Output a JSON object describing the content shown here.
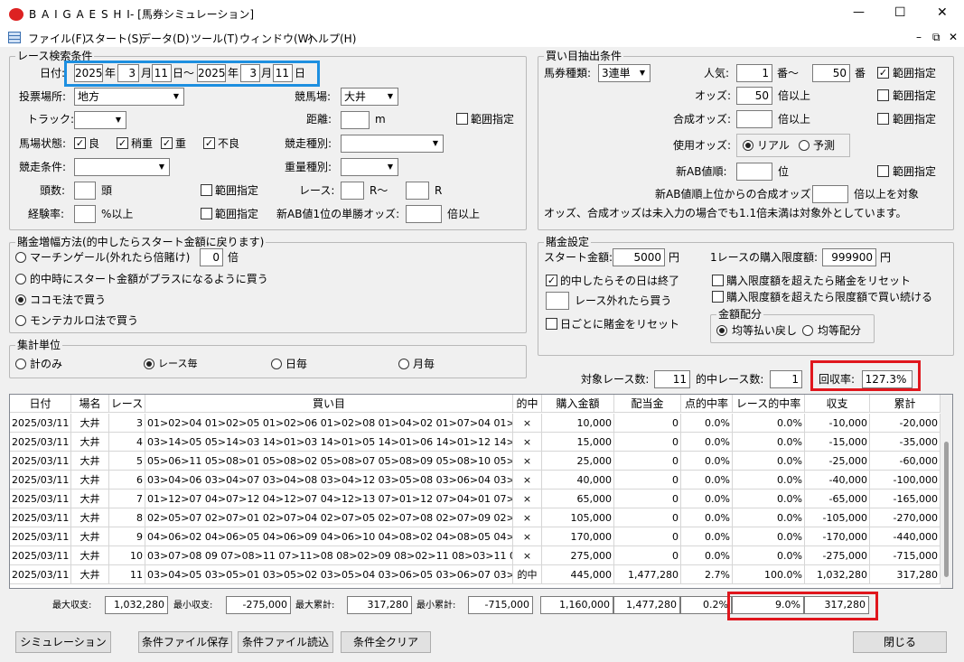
{
  "window": {
    "app_name": "B A I G A E S H I",
    "doc_title": "- [馬券シミュレーション]",
    "min": "—",
    "max": "☐",
    "close": "✕"
  },
  "menu": [
    "ファイル(F)",
    "スタート(S)",
    "データ(D)",
    "ツール(T)",
    "ウィンドウ(W)",
    "ヘルプ(H)"
  ],
  "mdi": [
    "–",
    "⧉",
    "✕"
  ],
  "race_search": {
    "legend": "レース検索条件",
    "date_label": "日付:",
    "y1": "2025",
    "y_unit": "年",
    "m1": "3",
    "m_unit": "月",
    "d1": "11",
    "d_unit_tilde": "日〜",
    "y2": "2025",
    "m2": "3",
    "d2": "11",
    "d_unit": "日",
    "venue_label": "投票場所:",
    "venue": "地方",
    "track_label": "競馬場:",
    "track": "大井",
    "course_label": "トラック:",
    "course": "",
    "distance_label": "距離:",
    "distance": "",
    "distance_unit": "m",
    "range": "範囲指定",
    "condition_label": "馬場状態:",
    "cond": [
      "良",
      "稍重",
      "重",
      "不良"
    ],
    "race_type_label": "競走種別:",
    "race_type": "",
    "race_cond_label": "競走条件:",
    "race_cond": "",
    "weight_label": "重量種別:",
    "weight": "",
    "heads_label": "頭数:",
    "heads_unit": "頭",
    "race_label": "レース:",
    "race_from": "",
    "race_mid": "R〜",
    "race_to": "",
    "race_unit": "R",
    "exp_label": "経験率:",
    "exp_unit": "%以上",
    "ab_label": "新AB値1位の単勝オッズ:",
    "ab_unit": "倍以上"
  },
  "bet_extract": {
    "legend": "買い目抽出条件",
    "type_label": "馬券種類:",
    "type": "3連単",
    "pop_label": "人気:",
    "pop_from": "1",
    "pop_mid": "番〜",
    "pop_to": "50",
    "pop_unit": "番",
    "range": "範囲指定",
    "odds_label": "オッズ:",
    "odds": "50",
    "odds_unit": "倍以上",
    "comb_label": "合成オッズ:",
    "comb_unit": "倍以上",
    "use_odds_label": "使用オッズ:",
    "real": "リアル",
    "pred": "予測",
    "ab_rank_label": "新AB値順:",
    "ab_rank_unit": "位",
    "ab_comb_label": "新AB値順上位からの合成オッズ",
    "ab_comb_unit": "倍以上を対象",
    "note": "オッズ、合成オッズは未入力の場合でも1.1倍未満は対象外としています。"
  },
  "increase": {
    "legend": "賭金増幅方法(的中したらスタート金額に戻ります)",
    "opt1": "マーチンゲール(外れたら倍賭け)",
    "opt1_val": "0",
    "opt1_unit": "倍",
    "opt2": "的中時にスタート金額がプラスになるように買う",
    "opt3": "ココモ法で買う",
    "opt4": "モンテカルロ法で買う"
  },
  "agg": {
    "legend": "集計単位",
    "o1": "計のみ",
    "o2": "レース毎",
    "o3": "日毎",
    "o4": "月毎"
  },
  "bet_set": {
    "legend": "賭金設定",
    "start_label": "スタート金額:",
    "start": "5000",
    "yen": "円",
    "limit_label": "1レースの購入限度額:",
    "limit": "999900",
    "c1": "的中したらその日は終了",
    "c2": "レース外れたら買う",
    "c3": "日ごとに賭金をリセット",
    "c4": "購入限度額を超えたら賭金をリセット",
    "c5": "購入限度額を超えたら限度額で買い続ける",
    "dist_legend": "金額配分",
    "d1": "均等払い戻し",
    "d2": "均等配分"
  },
  "summary": {
    "races_label": "対象レース数:",
    "races": "11",
    "hits_label": "的中レース数:",
    "hits": "1",
    "ret_label": "回収率:",
    "ret": "127.3%"
  },
  "grid": {
    "headers": [
      "日付",
      "場名",
      "レース",
      "買い目",
      "的中",
      "購入金額",
      "配当金",
      "点的中率",
      "レース的中率",
      "収支",
      "累計"
    ],
    "rows": [
      [
        "2025/03/11",
        "大井",
        "3",
        "01>02>04 01>02>05 01>02>06 01>02>08 01>04>02 01>07>04 01>07>08 01>07>",
        "×",
        "10,000",
        "0",
        "0.0%",
        "0.0%",
        "-10,000",
        "-20,000"
      ],
      [
        "2025/03/11",
        "大井",
        "4",
        "03>14>05 05>14>03 14>01>03 14>01>05 14>01>06 14>01>12 14>02>03 14>02>",
        "×",
        "15,000",
        "0",
        "0.0%",
        "0.0%",
        "-15,000",
        "-35,000"
      ],
      [
        "2025/03/11",
        "大井",
        "5",
        "05>06>11 05>08>01 05>08>02 05>08>07 05>08>09 05>08>10 05>11>08 06>05>",
        "×",
        "25,000",
        "0",
        "0.0%",
        "0.0%",
        "-25,000",
        "-60,000"
      ],
      [
        "2025/03/11",
        "大井",
        "6",
        "03>04>06 03>04>07 03>04>08 03>04>12 03>05>08 03>06>04 03>06>08 03>06>",
        "×",
        "40,000",
        "0",
        "0.0%",
        "0.0%",
        "-40,000",
        "-100,000"
      ],
      [
        "2025/03/11",
        "大井",
        "7",
        "01>12>07 04>07>12 04>12>07 04>12>13 07>01>12 07>04>01 07>04>12 07>04>",
        "×",
        "65,000",
        "0",
        "0.0%",
        "0.0%",
        "-65,000",
        "-165,000"
      ],
      [
        "2025/03/11",
        "大井",
        "8",
        "02>05>07 02>07>01 02>07>04 02>07>05 02>07>08 02>07>09 02>07>10 02>07>",
        "×",
        "105,000",
        "0",
        "0.0%",
        "0.0%",
        "-105,000",
        "-270,000"
      ],
      [
        "2025/03/11",
        "大井",
        "9",
        "04>06>02 04>06>05 04>06>09 04>06>10 04>08>02 04>08>05 04>08>09 04>08>",
        "×",
        "170,000",
        "0",
        "0.0%",
        "0.0%",
        "-170,000",
        "-440,000"
      ],
      [
        "2025/03/11",
        "大井",
        "10",
        "03>07>08 09 07>08>11 07>11>08 08>02>09 08>02>11 08>03>11 08>04>07 08>04>",
        "×",
        "275,000",
        "0",
        "0.0%",
        "0.0%",
        "-275,000",
        "-715,000"
      ],
      [
        "2025/03/11",
        "大井",
        "11",
        "03>04>05 03>05>01 03>05>02 03>05>04 03>06>05 03>06>07 03>07>05 03>07>",
        "的中",
        "445,000",
        "1,477,280",
        "2.7%",
        "100.0%",
        "1,032,280",
        "317,280"
      ]
    ]
  },
  "totals": {
    "max_inc_label": "最大収支:",
    "max_inc": "1,032,280",
    "min_inc_label": "最小収支:",
    "min_inc": "-275,000",
    "max_cum_label": "最大累計:",
    "max_cum": "317,280",
    "min_cum_label": "最小累計:",
    "min_cum": "-715,000",
    "buy": "1,160,000",
    "payout": "1,477,280",
    "pt_rate": "0.2%",
    "race_rate": "9.0%",
    "net": "317,280"
  },
  "buttons": {
    "sim": "シミュレーション",
    "save": "条件ファイル保存",
    "load": "条件ファイル読込",
    "clear": "条件全クリア",
    "close": "閉じる"
  }
}
